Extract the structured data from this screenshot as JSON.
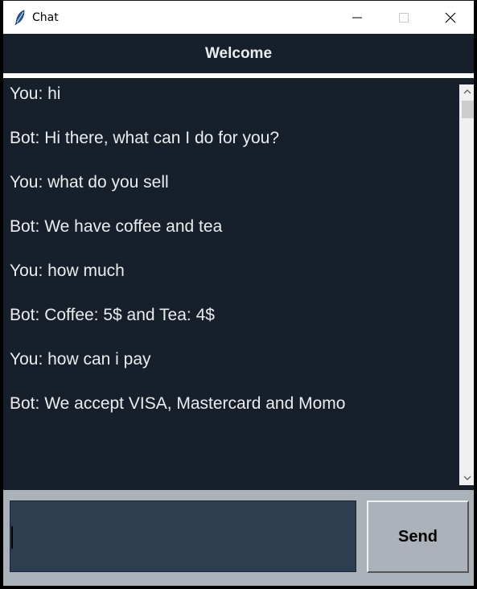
{
  "window": {
    "title": "Chat",
    "app_icon": "feather-icon",
    "controls": [
      "minimize-icon",
      "maximize-icon",
      "close-icon"
    ]
  },
  "header": {
    "title": "Welcome"
  },
  "messages": [
    "You: hi",
    "Bot: Hi there, what can I do for you?",
    "You: what do you sell",
    "Bot: We have coffee and tea",
    "You: how much",
    "Bot: Coffee: 5$ and Tea: 4$",
    "You: how can i pay",
    "Bot: We accept VISA, Mastercard and Momo"
  ],
  "input": {
    "value": "",
    "placeholder": ""
  },
  "send_button": {
    "label": "Send"
  },
  "colors": {
    "background_dark": "#17202A",
    "text": "#EAECEE",
    "input_bg": "#2C3E50",
    "bottom_bg": "#ABB2B9"
  }
}
